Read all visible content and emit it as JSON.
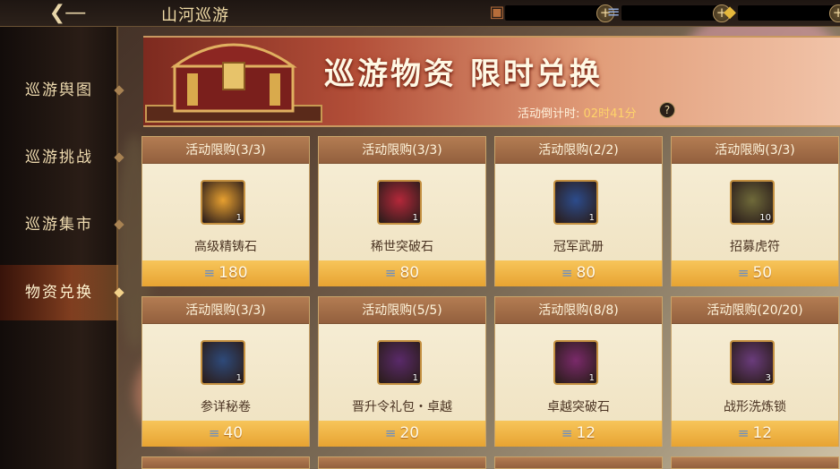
{
  "header": {
    "back_icon": "back-arrow-icon",
    "title": "山河巡游",
    "resources": [
      {
        "icon": "treasure-chest-icon",
        "value": ""
      },
      {
        "icon": "scroll-token-icon",
        "value": ""
      },
      {
        "icon": "gold-ingot-icon",
        "value": ""
      }
    ]
  },
  "sidebar": {
    "items": [
      {
        "label": "巡游舆图",
        "active": false
      },
      {
        "label": "巡游挑战",
        "active": false
      },
      {
        "label": "巡游集市",
        "active": false
      },
      {
        "label": "物资兑换",
        "active": true
      }
    ]
  },
  "banner": {
    "title": "巡游物资 限时兑换",
    "countdown_label": "活动倒计时:",
    "countdown_value": "02时41分",
    "help": "?"
  },
  "items": [
    {
      "limit": "活动限购(3/3)",
      "name": "高级精铸石",
      "qty": "1",
      "price": "180",
      "icon": "crystal-ore-icon",
      "color": "#e7a030"
    },
    {
      "limit": "活动限购(3/3)",
      "name": "稀世突破石",
      "qty": "1",
      "price": "80",
      "icon": "red-orb-icon",
      "color": "#b4283a"
    },
    {
      "limit": "活动限购(2/2)",
      "name": "冠军武册",
      "qty": "1",
      "price": "80",
      "icon": "blue-book-icon",
      "color": "#2c4c8c"
    },
    {
      "limit": "活动限购(3/3)",
      "name": "招募虎符",
      "qty": "10",
      "price": "50",
      "icon": "tiger-tally-icon",
      "color": "#6f6a3a"
    },
    {
      "limit": "活动限购(3/3)",
      "name": "参详秘卷",
      "qty": "1",
      "price": "40",
      "icon": "scroll-bundle-icon",
      "color": "#2e4a7a"
    },
    {
      "limit": "活动限购(5/5)",
      "name": "晋升令礼包・卓越",
      "qty": "1",
      "price": "20",
      "icon": "gift-pack-icon",
      "color": "#5a2a6a"
    },
    {
      "limit": "活动限购(8/8)",
      "name": "卓越突破石",
      "qty": "1",
      "price": "12",
      "icon": "gold-orb-icon",
      "color": "#7a2a6a"
    },
    {
      "limit": "活动限购(20/20)",
      "name": "战形洗炼锁",
      "qty": "3",
      "price": "12",
      "icon": "lock-icon",
      "color": "#6a3c7c"
    }
  ]
}
